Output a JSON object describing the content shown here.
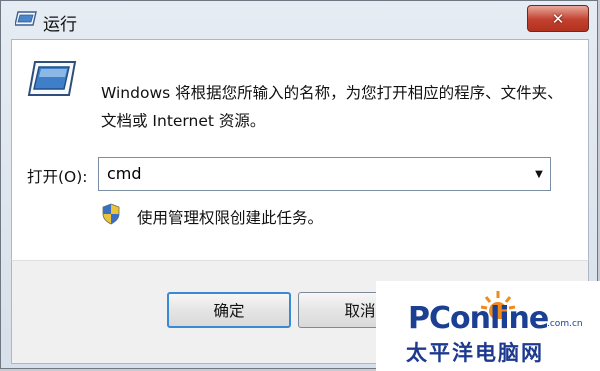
{
  "window": {
    "title": "运行",
    "close_glyph": "✕"
  },
  "content": {
    "description": "Windows 将根据您所输入的名称，为您打开相应的程序、文件夹、文档或 Internet 资源。",
    "open_label": "打开(O):",
    "open_value": "cmd",
    "admin_note": "使用管理权限创建此任务。"
  },
  "buttons": {
    "ok": "确定",
    "cancel": "取消"
  },
  "watermark": {
    "brand": "PConline",
    "domain": ".com.cn",
    "chinese": "太平洋电脑网"
  },
  "colors": {
    "accent": "#3a8ad3",
    "close": "#c2402e",
    "brand": "#1b3f93"
  }
}
